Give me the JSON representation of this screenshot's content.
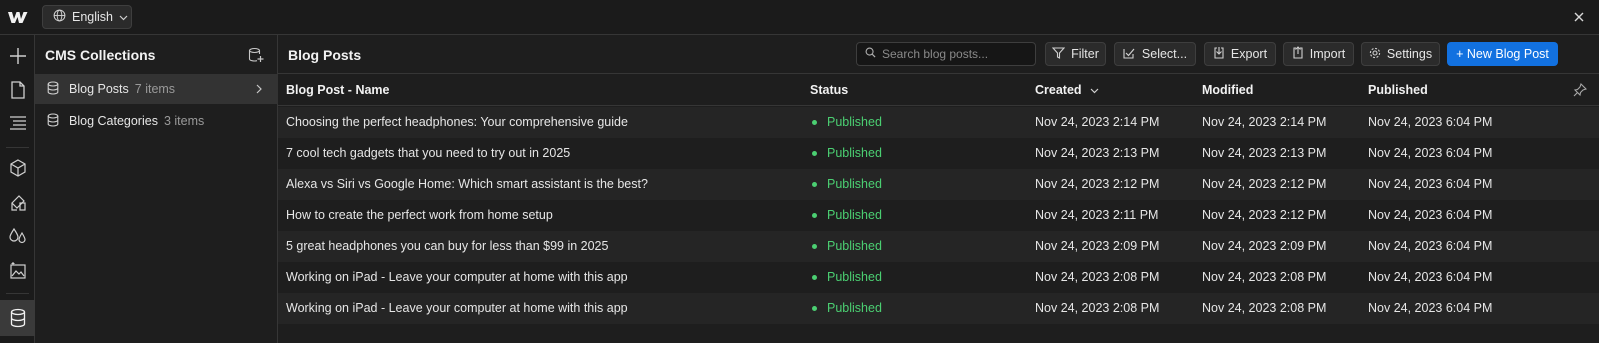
{
  "topbar": {
    "logo_icon": "webflow-logo-icon",
    "language": "English",
    "close_icon": "close-icon"
  },
  "rail": {
    "items": [
      "add-icon",
      "page-icon",
      "navigator-icon",
      "components-icon",
      "style-selector-icon",
      "variables-icon",
      "assets-icon",
      "cms-icon"
    ],
    "active": "cms-icon"
  },
  "collections": {
    "title": "CMS Collections",
    "items": [
      {
        "label": "Blog Posts",
        "count": "7 items",
        "active": true
      },
      {
        "label": "Blog Categories",
        "count": "3 items",
        "active": false
      }
    ]
  },
  "main": {
    "title": "Blog Posts",
    "search_placeholder": "Search blog posts...",
    "buttons": {
      "filter": "Filter",
      "select": "Select...",
      "export": "Export",
      "import": "Import",
      "settings": "Settings",
      "new": "+ New Blog Post"
    }
  },
  "table": {
    "headers": {
      "name": "Blog Post - Name",
      "status": "Status",
      "created": "Created",
      "modified": "Modified",
      "published": "Published"
    },
    "sorted_column": "created",
    "rows": [
      {
        "name": "Choosing the perfect headphones: Your comprehensive guide",
        "status": "Published",
        "created": "Nov 24, 2023 2:14 PM",
        "modified": "Nov 24, 2023 2:14 PM",
        "published": "Nov 24, 2023 6:04 PM"
      },
      {
        "name": "7 cool tech gadgets that you need to try out in 2025",
        "status": "Published",
        "created": "Nov 24, 2023 2:13 PM",
        "modified": "Nov 24, 2023 2:13 PM",
        "published": "Nov 24, 2023 6:04 PM"
      },
      {
        "name": "Alexa vs Siri vs Google Home: Which smart assistant is the best?",
        "status": "Published",
        "created": "Nov 24, 2023 2:12 PM",
        "modified": "Nov 24, 2023 2:12 PM",
        "published": "Nov 24, 2023 6:04 PM"
      },
      {
        "name": "How to create the perfect work from home setup",
        "status": "Published",
        "created": "Nov 24, 2023 2:11 PM",
        "modified": "Nov 24, 2023 2:12 PM",
        "published": "Nov 24, 2023 6:04 PM"
      },
      {
        "name": "5 great headphones you can buy for less than $99 in 2025",
        "status": "Published",
        "created": "Nov 24, 2023 2:09 PM",
        "modified": "Nov 24, 2023 2:09 PM",
        "published": "Nov 24, 2023 6:04 PM"
      },
      {
        "name": "Working on iPad - Leave your computer at home with this app",
        "status": "Published",
        "created": "Nov 24, 2023 2:08 PM",
        "modified": "Nov 24, 2023 2:08 PM",
        "published": "Nov 24, 2023 6:04 PM"
      },
      {
        "name": "Working on iPad - Leave your computer at home with this app",
        "status": "Published",
        "created": "Nov 24, 2023 2:08 PM",
        "modified": "Nov 24, 2023 2:08 PM",
        "published": "Nov 24, 2023 6:04 PM"
      }
    ]
  },
  "colors": {
    "accent": "#1271e0",
    "status_published": "#4bcf72",
    "background": "#1e1e1e"
  }
}
